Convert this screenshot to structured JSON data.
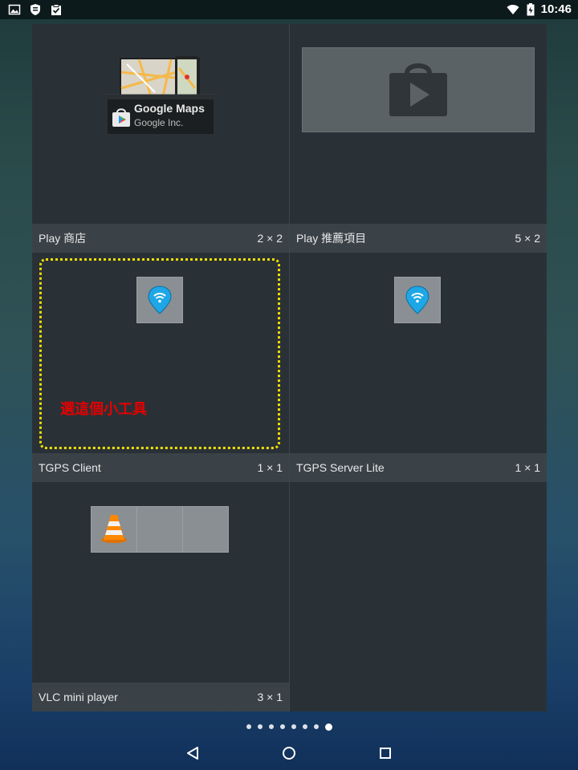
{
  "status_bar": {
    "time": "10:46",
    "left_icons": [
      "image-icon",
      "shield-icon",
      "clipboard-check-icon"
    ],
    "right_icons": [
      "wifi-icon",
      "battery-icon"
    ]
  },
  "widgets": [
    {
      "name": "Play 商店",
      "size": "2 × 2"
    },
    {
      "name": "Play 推薦項目",
      "size": "5 × 2"
    },
    {
      "name": "TGPS Client",
      "size": "1 × 1"
    },
    {
      "name": "TGPS Server Lite",
      "size": "1 × 1"
    },
    {
      "name": "VLC mini player",
      "size": "3 × 1"
    }
  ],
  "play_store_preview": {
    "app_title": "Google Maps",
    "app_publisher": "Google Inc."
  },
  "annotation": {
    "text": "選這個小工具",
    "color": "#e60000",
    "frame_color": "#f4e000"
  },
  "page_indicator": {
    "count": 8,
    "active_index": 7
  },
  "nav_bar": {
    "buttons": [
      "back-icon",
      "home-icon",
      "recents-icon"
    ]
  },
  "colors": {
    "panel": "#2a3136",
    "footer": "#3a4248",
    "preview": "#8a8f93"
  }
}
